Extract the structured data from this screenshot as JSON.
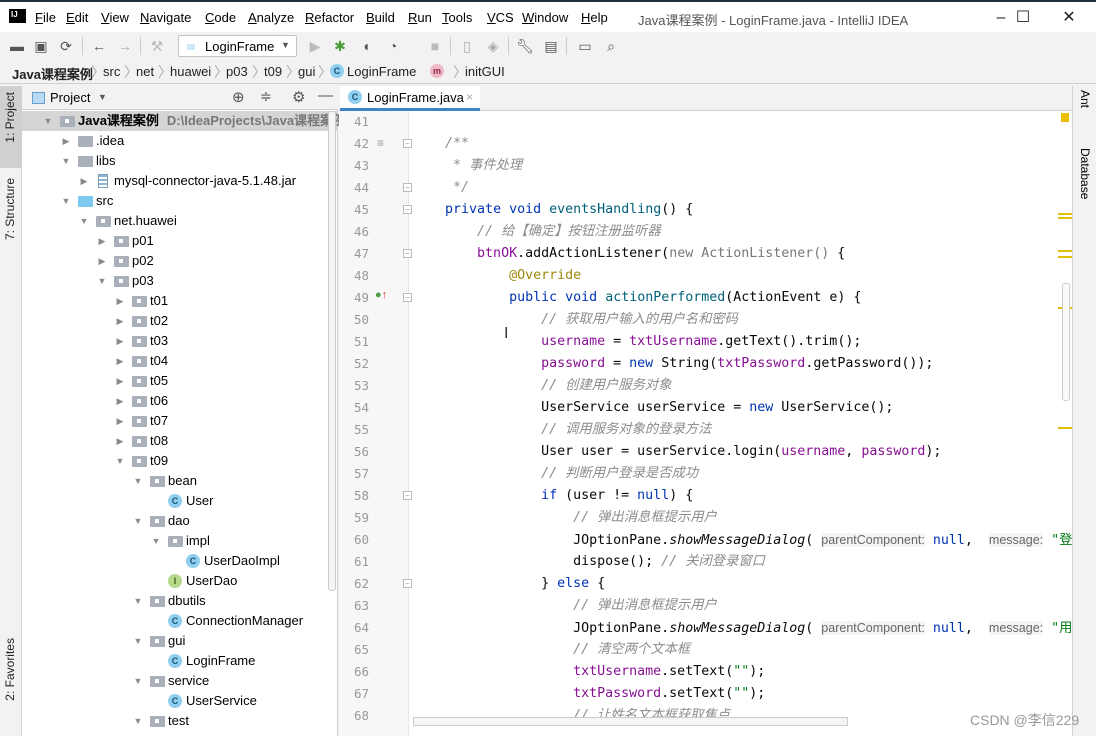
{
  "app": {
    "title": "Java课程案例 - LoginFrame.java - IntelliJ IDEA",
    "logo": "IJ"
  },
  "menu": [
    "File",
    "Edit",
    "View",
    "Navigate",
    "Code",
    "Analyze",
    "Refactor",
    "Build",
    "Run",
    "Tools",
    "VCS",
    "Window",
    "Help"
  ],
  "window_controls": {
    "minimize": "–",
    "maximize": "☐",
    "close": "✕"
  },
  "toolbar": {
    "run_config": "LoginFrame",
    "icons": [
      "open-icon",
      "save-icon",
      "sync-icon",
      "back-icon",
      "forward-icon",
      "build-hammer-icon",
      "run-icon",
      "debug-icon",
      "coverage-icon",
      "profile-icon",
      "stop-icon",
      "device-icon",
      "plugin-icon",
      "settings-wrench-icon",
      "project-structure-icon",
      "terminal-icon",
      "search-icon"
    ]
  },
  "breadcrumb": [
    "Java课程案例",
    "src",
    "net",
    "huawei",
    "p03",
    "t09",
    "gui",
    "LoginFrame",
    "initGUI"
  ],
  "left_strip": {
    "project": "1: Project",
    "structure": "7: Structure",
    "favorites": "2: Favorites"
  },
  "right_strip": {
    "ant": "Ant",
    "database": "Database"
  },
  "project_panel": {
    "title": "Project",
    "tree": [
      {
        "label": "Java课程案例",
        "path": "D:\\IdeaProjects\\Java课程案例",
        "depth": 0,
        "state": "open",
        "icon": "module",
        "selected": true
      },
      {
        "label": ".idea",
        "depth": 1,
        "state": "closed",
        "icon": "folder"
      },
      {
        "label": "libs",
        "depth": 1,
        "state": "open",
        "icon": "folder"
      },
      {
        "label": "mysql-connector-java-5.1.48.jar",
        "depth": 2,
        "state": "closed",
        "icon": "jar"
      },
      {
        "label": "src",
        "depth": 1,
        "state": "open",
        "icon": "src"
      },
      {
        "label": "net.huawei",
        "depth": 2,
        "state": "open",
        "icon": "package"
      },
      {
        "label": "p01",
        "depth": 3,
        "state": "closed",
        "icon": "package"
      },
      {
        "label": "p02",
        "depth": 3,
        "state": "closed",
        "icon": "package"
      },
      {
        "label": "p03",
        "depth": 3,
        "state": "open",
        "icon": "package"
      },
      {
        "label": "t01",
        "depth": 4,
        "state": "closed",
        "icon": "package"
      },
      {
        "label": "t02",
        "depth": 4,
        "state": "closed",
        "icon": "package"
      },
      {
        "label": "t03",
        "depth": 4,
        "state": "closed",
        "icon": "package"
      },
      {
        "label": "t04",
        "depth": 4,
        "state": "closed",
        "icon": "package"
      },
      {
        "label": "t05",
        "depth": 4,
        "state": "closed",
        "icon": "package"
      },
      {
        "label": "t06",
        "depth": 4,
        "state": "closed",
        "icon": "package"
      },
      {
        "label": "t07",
        "depth": 4,
        "state": "closed",
        "icon": "package"
      },
      {
        "label": "t08",
        "depth": 4,
        "state": "closed",
        "icon": "package"
      },
      {
        "label": "t09",
        "depth": 4,
        "state": "open",
        "icon": "package"
      },
      {
        "label": "bean",
        "depth": 5,
        "state": "open",
        "icon": "package"
      },
      {
        "label": "User",
        "depth": 6,
        "state": "none",
        "icon": "class"
      },
      {
        "label": "dao",
        "depth": 5,
        "state": "open",
        "icon": "package"
      },
      {
        "label": "impl",
        "depth": 6,
        "state": "open",
        "icon": "package"
      },
      {
        "label": "UserDaoImpl",
        "depth": 7,
        "state": "none",
        "icon": "class"
      },
      {
        "label": "UserDao",
        "depth": 6,
        "state": "none",
        "icon": "interface"
      },
      {
        "label": "dbutils",
        "depth": 5,
        "state": "open",
        "icon": "package"
      },
      {
        "label": "ConnectionManager",
        "depth": 6,
        "state": "none",
        "icon": "class"
      },
      {
        "label": "gui",
        "depth": 5,
        "state": "open",
        "icon": "package"
      },
      {
        "label": "LoginFrame",
        "depth": 6,
        "state": "none",
        "icon": "class"
      },
      {
        "label": "service",
        "depth": 5,
        "state": "open",
        "icon": "package"
      },
      {
        "label": "UserService",
        "depth": 6,
        "state": "none",
        "icon": "class"
      },
      {
        "label": "test",
        "depth": 5,
        "state": "open",
        "icon": "package"
      }
    ]
  },
  "editor": {
    "tab": "LoginFrame.java",
    "lines": [
      {
        "n": "41",
        "t": []
      },
      {
        "n": "42",
        "fold": true,
        "gicon": "doc",
        "t": [
          [
            "c",
            "    /**"
          ]
        ]
      },
      {
        "n": "43",
        "t": [
          [
            "c",
            "     * 事件处理"
          ]
        ]
      },
      {
        "n": "44",
        "fold": true,
        "t": [
          [
            "c",
            "     */"
          ]
        ]
      },
      {
        "n": "45",
        "fold": true,
        "t": [
          [
            "p",
            "    "
          ],
          [
            "k",
            "private"
          ],
          [
            "p",
            " "
          ],
          [
            "k",
            "void"
          ],
          [
            "p",
            " "
          ],
          [
            "d",
            "eventsHandling"
          ],
          [
            "p",
            "() {"
          ]
        ]
      },
      {
        "n": "46",
        "t": [
          [
            "p",
            "        "
          ],
          [
            "c",
            "// 给【确定】按钮注册监听器"
          ]
        ]
      },
      {
        "n": "47",
        "fold": true,
        "t": [
          [
            "p",
            "        "
          ],
          [
            "f",
            "btnOK"
          ],
          [
            "p",
            ".addActionListener("
          ],
          [
            "g",
            "new ActionListener()"
          ],
          [
            "p",
            " {"
          ]
        ]
      },
      {
        "n": "48",
        "t": [
          [
            "p",
            "            "
          ],
          [
            "a",
            "@Override"
          ]
        ]
      },
      {
        "n": "49",
        "fold": true,
        "gicon": "override",
        "t": [
          [
            "p",
            "            "
          ],
          [
            "k",
            "public"
          ],
          [
            "p",
            " "
          ],
          [
            "k",
            "void"
          ],
          [
            "p",
            " "
          ],
          [
            "d",
            "actionPerformed"
          ],
          [
            "p",
            "(ActionEvent e) {"
          ]
        ]
      },
      {
        "n": "50",
        "t": [
          [
            "p",
            "                "
          ],
          [
            "c",
            "// 获取用户输入的用户名和密码"
          ]
        ]
      },
      {
        "n": "51",
        "t": [
          [
            "p",
            "                "
          ],
          [
            "f",
            "username"
          ],
          [
            "p",
            " = "
          ],
          [
            "f",
            "txtUsername"
          ],
          [
            "p",
            ".getText().trim();"
          ]
        ]
      },
      {
        "n": "52",
        "t": [
          [
            "p",
            "                "
          ],
          [
            "f",
            "password"
          ],
          [
            "p",
            " = "
          ],
          [
            "k",
            "new"
          ],
          [
            "p",
            " String("
          ],
          [
            "f",
            "txtPassword"
          ],
          [
            "p",
            ".getPassword());"
          ]
        ]
      },
      {
        "n": "53",
        "t": [
          [
            "p",
            "                "
          ],
          [
            "c",
            "// 创建用户服务对象"
          ]
        ]
      },
      {
        "n": "54",
        "t": [
          [
            "p",
            "                UserService userService = "
          ],
          [
            "k",
            "new"
          ],
          [
            "p",
            " UserService();"
          ]
        ]
      },
      {
        "n": "55",
        "t": [
          [
            "p",
            "                "
          ],
          [
            "c",
            "// 调用服务对象的登录方法"
          ]
        ]
      },
      {
        "n": "56",
        "t": [
          [
            "p",
            "                User user = userService.login("
          ],
          [
            "f",
            "username"
          ],
          [
            "p",
            ", "
          ],
          [
            "f",
            "password"
          ],
          [
            "p",
            ");"
          ]
        ]
      },
      {
        "n": "57",
        "t": [
          [
            "p",
            "                "
          ],
          [
            "c",
            "// 判断用户登录是否成功"
          ]
        ]
      },
      {
        "n": "58",
        "fold": true,
        "t": [
          [
            "p",
            "                "
          ],
          [
            "k",
            "if"
          ],
          [
            "p",
            " (user != "
          ],
          [
            "k",
            "null"
          ],
          [
            "p",
            ") {"
          ]
        ]
      },
      {
        "n": "59",
        "t": [
          [
            "p",
            "                    "
          ],
          [
            "c",
            "// 弹出消息框提示用户"
          ]
        ]
      },
      {
        "n": "60",
        "t": [
          [
            "p",
            "                    JOptionPane."
          ],
          [
            "i",
            "showMessageDialog"
          ],
          [
            "p",
            "( "
          ],
          [
            "h",
            "parentComponent:"
          ],
          [
            "p",
            " "
          ],
          [
            "k",
            "null"
          ],
          [
            "p",
            ",  "
          ],
          [
            "h",
            "message:"
          ],
          [
            "p",
            " "
          ],
          [
            "s",
            "\"登"
          ]
        ]
      },
      {
        "n": "61",
        "t": [
          [
            "p",
            "                    dispose(); "
          ],
          [
            "c",
            "// 关闭登录窗口"
          ]
        ]
      },
      {
        "n": "62",
        "fold": true,
        "t": [
          [
            "p",
            "                } "
          ],
          [
            "k",
            "else"
          ],
          [
            "p",
            " {"
          ]
        ]
      },
      {
        "n": "63",
        "t": [
          [
            "p",
            "                    "
          ],
          [
            "c",
            "// 弹出消息框提示用户"
          ]
        ]
      },
      {
        "n": "64",
        "t": [
          [
            "p",
            "                    JOptionPane."
          ],
          [
            "i",
            "showMessageDialog"
          ],
          [
            "p",
            "( "
          ],
          [
            "h",
            "parentComponent:"
          ],
          [
            "p",
            " "
          ],
          [
            "k",
            "null"
          ],
          [
            "p",
            ",  "
          ],
          [
            "h",
            "message:"
          ],
          [
            "p",
            " "
          ],
          [
            "s",
            "\"用"
          ]
        ]
      },
      {
        "n": "65",
        "t": [
          [
            "p",
            "                    "
          ],
          [
            "c",
            "// 清空两个文本框"
          ]
        ]
      },
      {
        "n": "66",
        "t": [
          [
            "p",
            "                    "
          ],
          [
            "f",
            "txtUsername"
          ],
          [
            "p",
            ".setText("
          ],
          [
            "s",
            "\"\""
          ],
          [
            "p",
            ");"
          ]
        ]
      },
      {
        "n": "67",
        "t": [
          [
            "p",
            "                    "
          ],
          [
            "f",
            "txtPassword"
          ],
          [
            "p",
            ".setText("
          ],
          [
            "s",
            "\"\""
          ],
          [
            "p",
            ");"
          ]
        ]
      },
      {
        "n": "68",
        "t": [
          [
            "p",
            "                    "
          ],
          [
            "c",
            "// 让姓名文本框获取焦点"
          ]
        ]
      }
    ]
  },
  "watermark": "CSDN @李信229",
  "colors": {
    "keyword": "#0033b3",
    "comment": "#8c8c8c",
    "field": "#871094",
    "annotation": "#9e880d",
    "tab_accent": "#4083c9",
    "marker": "#e0c000"
  }
}
